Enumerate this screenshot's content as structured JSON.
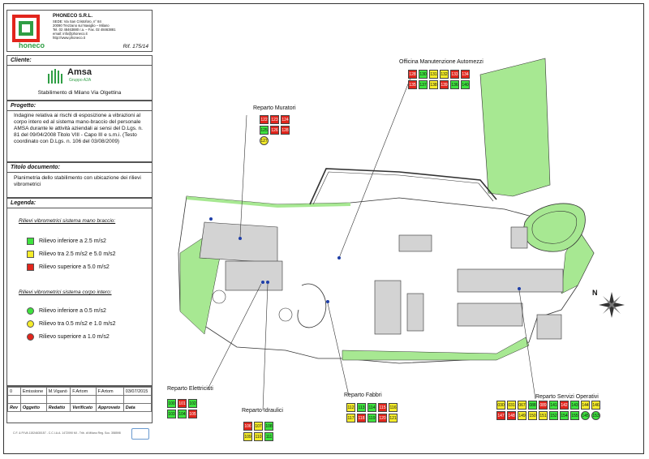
{
  "company": {
    "name": "PHONECO S.R.L.",
    "lines": [
      "SEDE: Via San Cristoforo, n° 84",
      "20090 Trezzano sul Naviglio – Milano",
      "Tel. 02 48463880 r.a. – Fax. 02 48463881",
      "email: info@phoneco.it",
      "http://www.phoneco.it"
    ],
    "logo_text": "honeco"
  },
  "ref": "Rif. 175/14",
  "cliente": {
    "label": "Cliente:",
    "logo": "Amsa",
    "logo_sub": "Gruppo A2A",
    "site": "Stabilimento di Milano Via Olgettina"
  },
  "progetto": {
    "label": "Progetto:",
    "text": "Indagine relativa ai rischi di esposizione a vibrazioni al corpo intero ed al sistema mano-braccio del personale AMSA durante le attività aziendali ai sensi del D.Lgs. n. 81 del 09/04/2008 Titolo VIII - Capo III e s.m.i. (Testo coordinato con D.Lgs. n. 106 del 03/08/2009)"
  },
  "titolo": {
    "label": "Titolo documento:",
    "text": "Planimetria dello stabilimento con ubicazione dei rilievi vibrometrici"
  },
  "legenda": {
    "label": "Legenda:",
    "hand_title": "Rilievi vibrometrici sistema mano braccio:",
    "hand_items": [
      {
        "text": "Rilievo inferiore a 2.5 m/s2",
        "color": "#3ee23e"
      },
      {
        "text": "Rilievo tra 2.5 m/s2 e 5.0 m/s2",
        "color": "#f5ec2a"
      },
      {
        "text": "Rilievo superiore a 5.0 m/s2",
        "color": "#e2251c"
      }
    ],
    "body_title": "Rilievi vibrometrici sistema corpo intero:",
    "body_items": [
      {
        "text": "Rilievo inferiore a 0.5 m/s2",
        "color": "#3ee23e"
      },
      {
        "text": "Rilievo tra 0.5 m/s2 e 1.0 m/s2",
        "color": "#f5ec2a"
      },
      {
        "text": "Rilievo superiore a 1.0 m/s2",
        "color": "#e2251c"
      }
    ]
  },
  "revision": {
    "row": [
      "0",
      "Emissione",
      "M.Viganò",
      "F.Artom",
      "F.Artom",
      "03/07/2015"
    ],
    "headers": [
      "Rev",
      "Oggetto",
      "Redatto",
      "Verificato",
      "Approvato",
      "Data"
    ]
  },
  "footer": "C.F. & P.IVA 11524630157 - C.C.I.A.A. 1472090 MI - Trib. di Milano Reg. Soc. 358598",
  "compass_letter": "N",
  "departments": [
    {
      "name": "Officina Manutenzione Automezzi",
      "cells": [
        [
          "128",
          "R"
        ],
        [
          "130",
          "G"
        ],
        [
          "131",
          "Y"
        ],
        [
          "132",
          "Y"
        ],
        [
          "133",
          "R"
        ],
        [
          "134",
          "R"
        ],
        [
          "135",
          "R"
        ],
        [
          "137",
          "G"
        ],
        [
          "138",
          "Y"
        ],
        [
          "139",
          "R"
        ],
        [
          "136",
          "G"
        ],
        [
          "140",
          "G"
        ]
      ]
    },
    {
      "name": "Reparto Muratori",
      "cells": [
        [
          "122",
          "R"
        ],
        [
          "123",
          "R"
        ],
        [
          "124",
          "R"
        ],
        [
          "125",
          "G"
        ],
        [
          "126",
          "R"
        ],
        [
          "128",
          "R"
        ]
      ],
      "circles": [
        [
          "127",
          "Y"
        ]
      ]
    },
    {
      "name": "Reparto Elettricisti",
      "cells": [
        [
          "100",
          "G"
        ],
        [
          "101",
          "R"
        ],
        [
          "102",
          "G"
        ],
        [
          "103",
          "G"
        ],
        [
          "104",
          "G"
        ],
        [
          "105",
          "R"
        ]
      ]
    },
    {
      "name": "Reparto Idraulici",
      "cells": [
        [
          "106",
          "R"
        ],
        [
          "107",
          "Y"
        ],
        [
          "108",
          "G"
        ],
        [
          "109",
          "Y"
        ],
        [
          "110",
          "Y"
        ],
        [
          "111",
          "G"
        ]
      ]
    },
    {
      "name": "Reparto Fabbri",
      "cells": [
        [
          "112",
          "Y"
        ],
        [
          "113",
          "G"
        ],
        [
          "114",
          "G"
        ],
        [
          "115",
          "R"
        ],
        [
          "116",
          "Y"
        ],
        [
          "117",
          "Y"
        ],
        [
          "118",
          "R"
        ],
        [
          "119",
          "G"
        ],
        [
          "120",
          "R"
        ],
        [
          "121",
          "Y"
        ]
      ]
    },
    {
      "name": "Reparto Servizi Operativi",
      "cells": [
        [
          "030",
          "Y"
        ],
        [
          "031",
          "Y"
        ],
        [
          "067",
          "Y"
        ],
        [
          "088",
          "G"
        ],
        [
          "089",
          "R"
        ],
        [
          "141",
          "G"
        ],
        [
          "142",
          "R"
        ],
        [
          "143",
          "G"
        ],
        [
          "144",
          "Y"
        ],
        [
          "146",
          "Y"
        ],
        [
          "147",
          "R"
        ],
        [
          "148",
          "R"
        ],
        [
          "149",
          "Y"
        ],
        [
          "150",
          "Y"
        ],
        [
          "151",
          "Y"
        ],
        [
          "152",
          "G"
        ],
        [
          "154",
          "G"
        ],
        [
          "155",
          "G"
        ]
      ],
      "circles": [
        [
          "145",
          "G"
        ],
        [
          "153",
          "G"
        ]
      ]
    }
  ]
}
